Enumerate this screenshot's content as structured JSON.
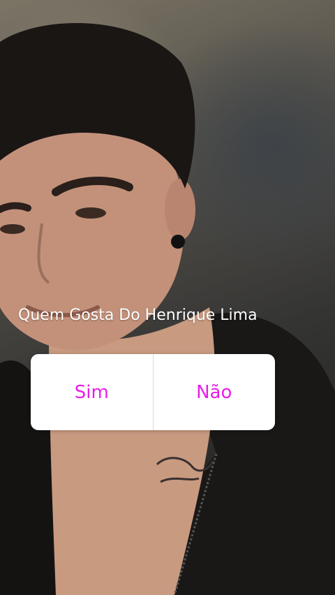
{
  "story": {
    "background": "portrait-photo",
    "poll": {
      "question": "Quem Gosta Do Henrique Lima",
      "options": [
        {
          "label": "Sim"
        },
        {
          "label": "Não"
        }
      ],
      "accent_color": "#E91EE9"
    }
  }
}
